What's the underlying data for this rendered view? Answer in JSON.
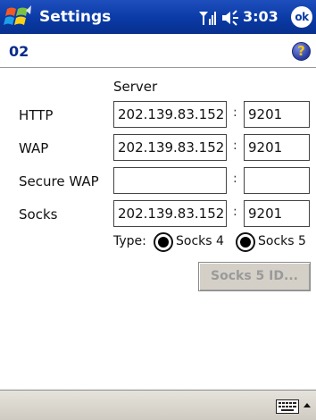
{
  "titlebar": {
    "app_title": "Settings",
    "clock": "3:03",
    "ok_label": "ok",
    "icons": [
      "windows-start-icon",
      "signal-icon",
      "volume-icon"
    ]
  },
  "subheader": {
    "page_label": "02",
    "help_label": "?"
  },
  "form": {
    "server_header": "Server",
    "separator": ":",
    "rows": [
      {
        "label": "HTTP",
        "server": "202.139.83.152",
        "port": "9201"
      },
      {
        "label": "WAP",
        "server": "202.139.83.152",
        "port": "9201"
      },
      {
        "label": "Secure WAP",
        "server": "",
        "port": ""
      },
      {
        "label": "Socks",
        "server": "202.139.83.152",
        "port": "9201"
      }
    ],
    "type_label": "Type:",
    "type_options": [
      {
        "label": "Socks 4",
        "selected": true
      },
      {
        "label": "Socks 5",
        "selected": true
      }
    ],
    "socks5_button": "Socks 5 ID..."
  },
  "bottombar": {
    "icons": [
      "keyboard-icon",
      "sip-arrow-up-icon"
    ]
  },
  "colors": {
    "titlebar": "#0a3aa5",
    "page_label": "#0a2a8c",
    "button_disabled_text": "#9a9a9a"
  }
}
